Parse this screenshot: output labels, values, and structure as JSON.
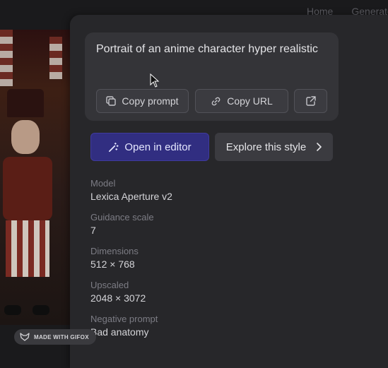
{
  "background": {
    "nav": [
      "Home",
      "Generate"
    ]
  },
  "prompt": {
    "text": "Portrait of an anime character hyper realistic",
    "copy_prompt_label": "Copy prompt",
    "copy_url_label": "Copy URL"
  },
  "actions": {
    "open_editor_label": "Open in editor",
    "explore_style_label": "Explore this style"
  },
  "details": [
    {
      "label": "Model",
      "value": "Lexica Aperture v2"
    },
    {
      "label": "Guidance scale",
      "value": "7"
    },
    {
      "label": "Dimensions",
      "value": "512 × 768"
    },
    {
      "label": "Upscaled",
      "value": "2048 × 3072"
    },
    {
      "label": "Negative prompt",
      "value": "Bad anatomy"
    }
  ],
  "watermark": {
    "text": "MADE WITH GIFOX"
  },
  "colors": {
    "accent": "#312e81",
    "panel": "#27272a",
    "card": "#343438"
  }
}
